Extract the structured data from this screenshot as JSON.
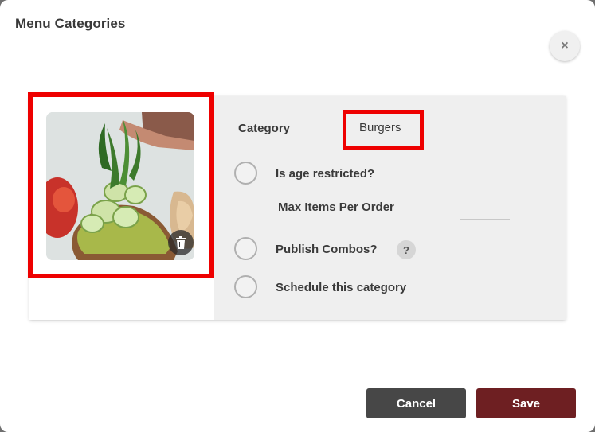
{
  "dialog": {
    "title": "Menu Categories",
    "close_icon": "close-icon",
    "close_glyph": "×"
  },
  "image": {
    "alt": "food photo",
    "delete_icon": "trash-icon"
  },
  "form": {
    "category_label": "Category",
    "category_value": "Burgers",
    "age_restricted_label": "Is age restricted?",
    "max_items_label": "Max Items Per Order",
    "max_items_value": "",
    "publish_combos_label": "Publish Combos?",
    "help_glyph": "?",
    "schedule_label": "Schedule this category"
  },
  "footer": {
    "cancel_label": "Cancel",
    "save_label": "Save"
  },
  "colors": {
    "save": "#6e1f22",
    "cancel": "#474747",
    "highlight": "#ee0000"
  }
}
